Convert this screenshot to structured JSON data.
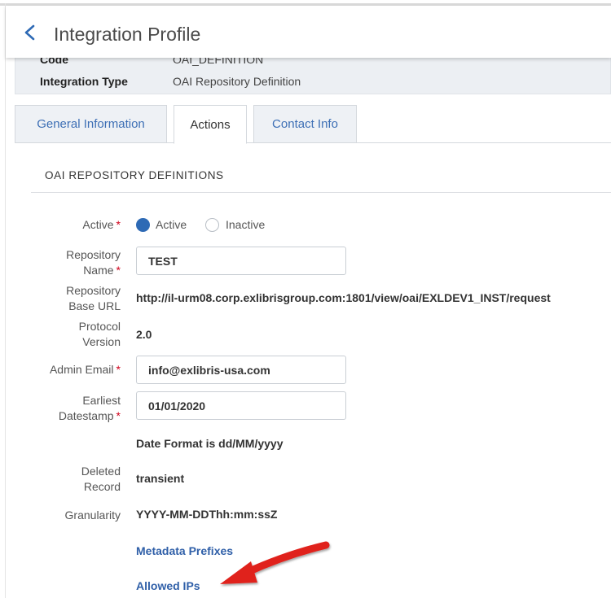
{
  "header": {
    "title": "Integration Profile",
    "back_icon": "chevron-left-icon"
  },
  "summary": {
    "code_label": "Code",
    "code_value": "OAI_DEFINITION",
    "type_label": "Integration Type",
    "type_value": "OAI Repository Definition"
  },
  "tabs": [
    {
      "label": "General Information",
      "active": false
    },
    {
      "label": "Actions",
      "active": true
    },
    {
      "label": "Contact Info",
      "active": false
    }
  ],
  "section": {
    "title": "OAI REPOSITORY DEFINITIONS"
  },
  "form": {
    "active": {
      "label": "Active",
      "option_active": "Active",
      "option_inactive": "Inactive",
      "selected": "Active"
    },
    "repository_name": {
      "label_line1": "Repository",
      "label_line2": "Name",
      "value": "TEST"
    },
    "repository_base_url": {
      "label_line1": "Repository",
      "label_line2": "Base URL",
      "value": "http://il-urm08.corp.exlibrisgroup.com:1801/view/oai/EXLDEV1_INST/request"
    },
    "protocol_version": {
      "label_line1": "Protocol",
      "label_line2": "Version",
      "value": "2.0"
    },
    "admin_email": {
      "label": "Admin Email",
      "value": "info@exlibris-usa.com"
    },
    "earliest_datestamp": {
      "label_line1": "Earliest",
      "label_line2": "Datestamp",
      "value": "01/01/2020"
    },
    "date_format_note": "Date Format is dd/MM/yyyy",
    "deleted_record": {
      "label_line1": "Deleted",
      "label_line2": "Record",
      "value": "transient"
    },
    "granularity": {
      "label": "Granularity",
      "value": "YYYY-MM-DDThh:mm:ssZ"
    },
    "required_mark": "*"
  },
  "links": {
    "metadata_prefixes": "Metadata Prefixes",
    "allowed_ips": "Allowed IPs"
  },
  "colors": {
    "accent": "#2e6ab5",
    "link": "#2f5fa8",
    "required": "#d0021b",
    "annotation_arrow": "#e0231b"
  }
}
